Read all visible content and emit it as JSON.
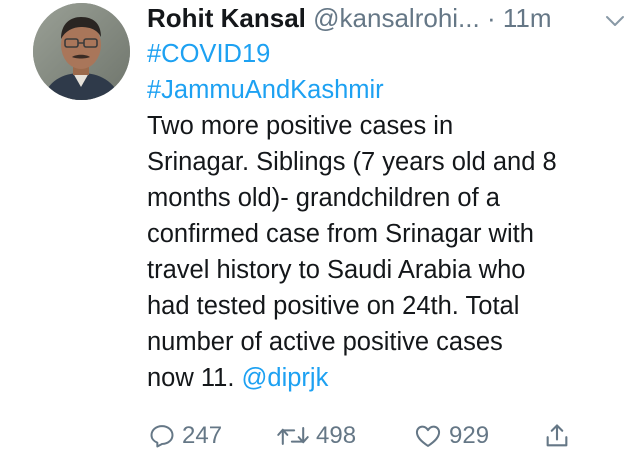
{
  "tweet": {
    "author": {
      "display_name": "Rohit Kansal",
      "handle": "@kansalrohi...",
      "avatar_icon": "profile-photo"
    },
    "separator": "·",
    "time": "11m",
    "menu_icon": "chevron-down-icon",
    "hashtags": [
      "#COVID19",
      "#JammuAndKashmir"
    ],
    "text_lines": [
      "Two more positive cases in",
      "Srinagar. Siblings (7 years old and 8",
      "months old)- grandchildren of a",
      "confirmed case from Srinagar with",
      "travel history to Saudi Arabia who",
      "had tested positive on 24th. Total",
      "number of active positive cases",
      "now 11."
    ],
    "mention": "@diprjk",
    "actions": {
      "replies": "247",
      "retweets": "498",
      "likes": "929",
      "reply_icon": "reply-icon",
      "retweet_icon": "retweet-icon",
      "like_icon": "heart-icon",
      "share_icon": "share-icon"
    },
    "colors": {
      "link": "#1da1f2",
      "secondary_text": "#657786",
      "primary_text": "#14171a"
    }
  }
}
